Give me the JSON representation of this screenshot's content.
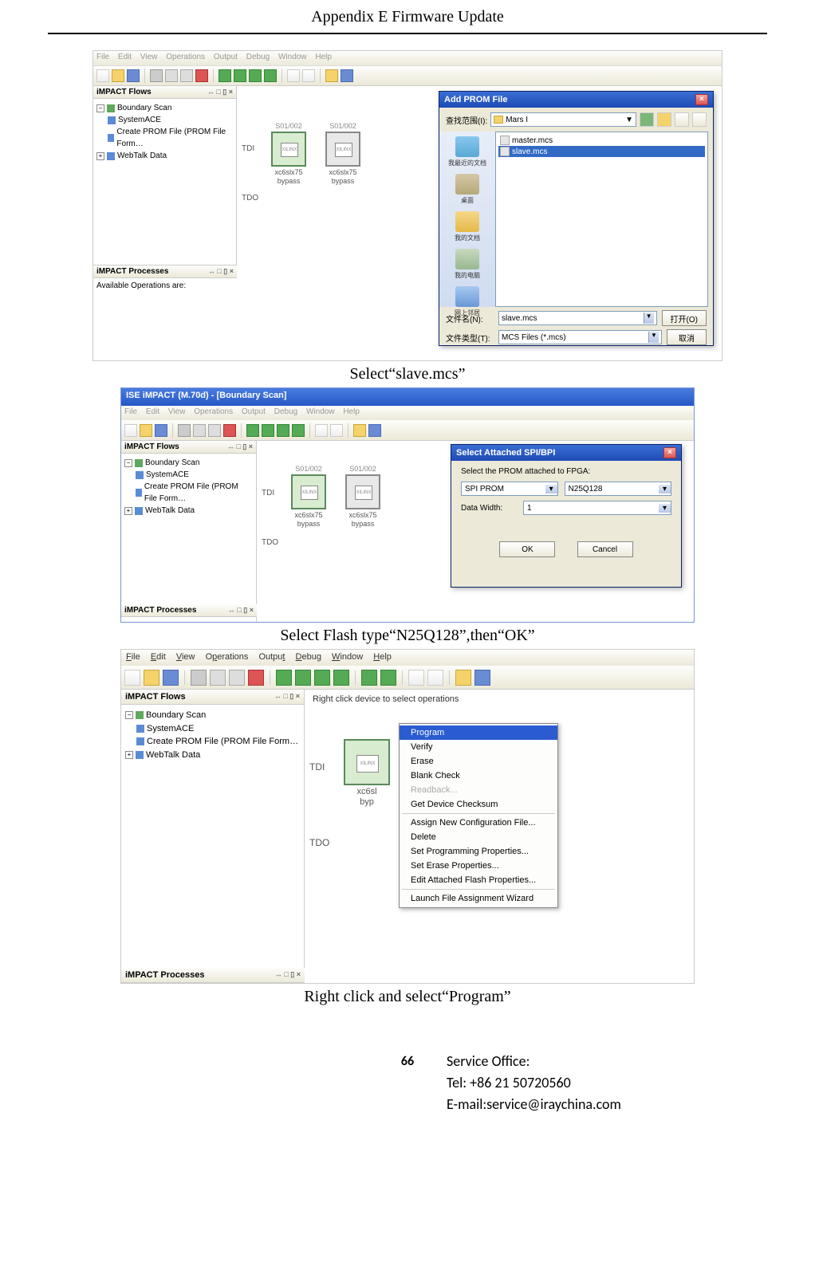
{
  "header": "Appendix E Firmware Update",
  "captions": {
    "c1": "Select“slave.mcs”",
    "c2": "Select Flash type“N25Q128”,then“OK”",
    "c3": "Right click and select“Program”"
  },
  "menubar": {
    "items": [
      "File",
      "Edit",
      "View",
      "Operations",
      "Output",
      "Debug",
      "Window",
      "Help"
    ]
  },
  "menubar3": {
    "items": [
      "File",
      "Edit",
      "View",
      "Operations",
      "Output",
      "Debug",
      "Window",
      "Help"
    ],
    "underlineKeys": [
      "F",
      "E",
      "V",
      "p",
      "t",
      "D",
      "W",
      "H"
    ]
  },
  "flows_pane": {
    "title": "iMPACT Flows",
    "ctrls": "↔ □ ▯ ×",
    "items": [
      "Boundary Scan",
      "SystemACE",
      "Create PROM File (PROM File Form…",
      "WebTalk Data"
    ],
    "items3": [
      "Boundary Scan",
      "SystemACE",
      "Create PROM File (PROM File Form…",
      "WebTalk Data"
    ]
  },
  "proc_pane": {
    "title": "iMPACT Processes",
    "ctrls": "↔ □ ▯ ×",
    "text": "Available Operations are:"
  },
  "chips": {
    "top1": "S01/002",
    "top2": "S01/002",
    "inner": "XILINX",
    "bot1a": "xc6slx75",
    "bot1b": "bypass",
    "bot2a": "xc6slx75",
    "bot2b": "bypass",
    "tdi": "TDI",
    "tdo": "TDO"
  },
  "dlg1": {
    "title": "Add PROM File",
    "lookin_label": "查找范围(I):",
    "folder": "Mars I",
    "files": {
      "master": "master.mcs",
      "slave": "slave.mcs"
    },
    "places": {
      "recent": "我最近的文档",
      "desktop": "桌面",
      "mydocs": "我的文档",
      "mycomp": "我的电脑",
      "mynet": "网上邻居"
    },
    "fn_label": "文件名(N):",
    "fn_value": "slave.mcs",
    "ft_label": "文件类型(T):",
    "ft_value": "MCS Files (*.mcs)",
    "open": "打开(O)",
    "cancel": "取消"
  },
  "ss2": {
    "title": "ISE iMPACT (M.70d) - [Boundary Scan]"
  },
  "dlg2": {
    "title": "Select Attached SPI/BPI",
    "msg": "Select the PROM attached to FPGA:",
    "type_label": "SPI PROM",
    "type_value": "N25Q128",
    "width_label": "Data Width:",
    "width_value": "1",
    "ok": "OK",
    "cancel": "Cancel"
  },
  "ss3": {
    "hint": "Right click device to select operations",
    "bot3a": "xc6sl",
    "bot3b": "byp"
  },
  "ctxmenu": {
    "items": [
      {
        "label": "Program",
        "sel": true
      },
      {
        "label": "Verify"
      },
      {
        "label": "Erase"
      },
      {
        "label": "Blank Check"
      },
      {
        "label": "Readback...",
        "disabled": true
      },
      {
        "label": "Get Device Checksum"
      },
      {
        "sep": true
      },
      {
        "label": "Assign New Configuration File..."
      },
      {
        "label": "Delete"
      },
      {
        "label": "Set Programming Properties..."
      },
      {
        "label": "Set Erase Properties..."
      },
      {
        "label": "Edit Attached Flash Properties..."
      },
      {
        "sep": true
      },
      {
        "label": "Launch File Assignment Wizard"
      }
    ]
  },
  "footer": {
    "page": "66",
    "office": "Service Office:",
    "tel": "Tel: +86 21 50720560",
    "email": "E-mail:service@iraychina.com"
  }
}
